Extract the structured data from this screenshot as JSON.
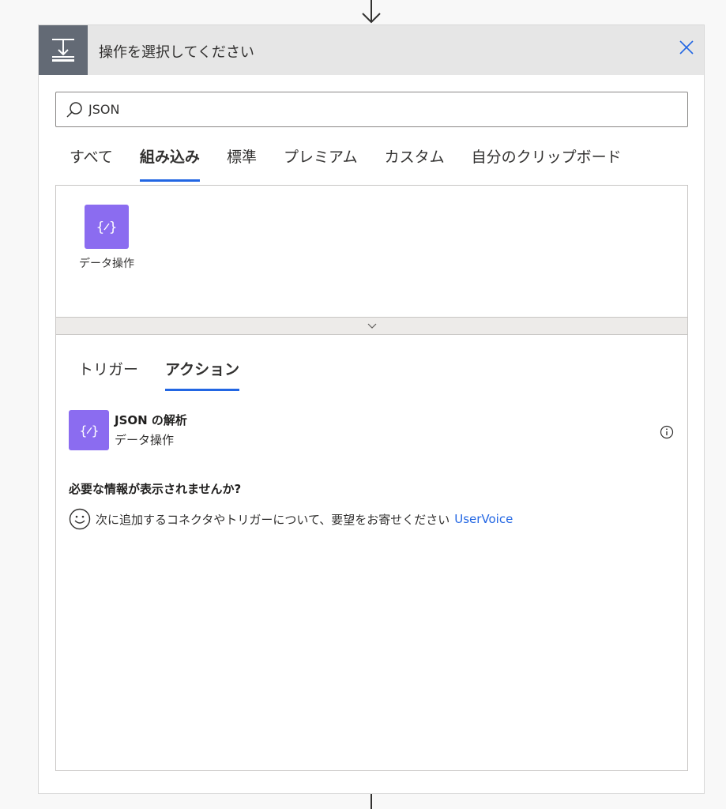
{
  "dialog": {
    "title": "操作を選択してください",
    "close_label": "close"
  },
  "search": {
    "value": "JSON",
    "placeholder": ""
  },
  "tabs": [
    {
      "label": "すべて",
      "active": false
    },
    {
      "label": "組み込み",
      "active": true
    },
    {
      "label": "標準",
      "active": false
    },
    {
      "label": "プレミアム",
      "active": false
    },
    {
      "label": "カスタム",
      "active": false
    },
    {
      "label": "自分のクリップボード",
      "active": false
    }
  ],
  "connectors": [
    {
      "label": "データ操作",
      "icon": "data-operation-icon",
      "color": "#8b6cf0"
    }
  ],
  "sub_tabs": [
    {
      "label": "トリガー",
      "active": false
    },
    {
      "label": "アクション",
      "active": true
    }
  ],
  "actions": [
    {
      "title": "JSON の解析",
      "subtitle": "データ操作",
      "icon": "data-operation-icon"
    }
  ],
  "help": {
    "heading": "必要な情報が表示されませんか?",
    "text": "次に追加するコネクタやトリガーについて、要望をお寄せください",
    "link": "UserVoice"
  },
  "colors": {
    "accent": "#2266e3",
    "connector": "#8b6cf0",
    "header_icon_bg": "#636a75"
  }
}
